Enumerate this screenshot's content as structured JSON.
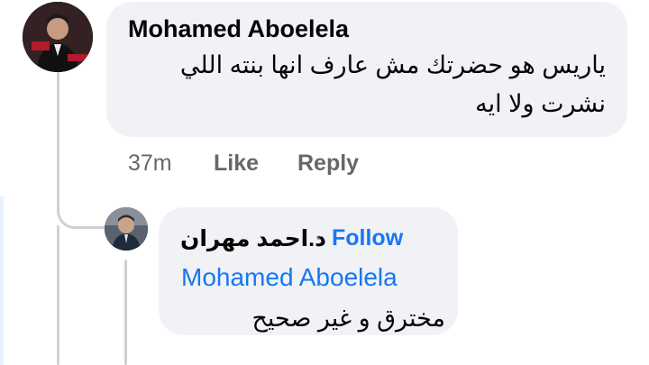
{
  "comment": {
    "author": "Mohamed Aboelela",
    "text_line1": "ياريس هو حضرتك مش عارف انها بنته اللي",
    "text_line2": "نشرت ولا ايه",
    "time": "37m",
    "like_label": "Like",
    "reply_label": "Reply"
  },
  "reply": {
    "author": "د.احمد مهران",
    "separator": "·",
    "follow_label": "Follow",
    "mention": "Mohamed Aboelela",
    "text": "مخترق و غير صحيح"
  },
  "colors": {
    "link_blue": "#1877f2",
    "bubble_gray": "#f0f2f5",
    "meta_gray": "#65676b"
  }
}
